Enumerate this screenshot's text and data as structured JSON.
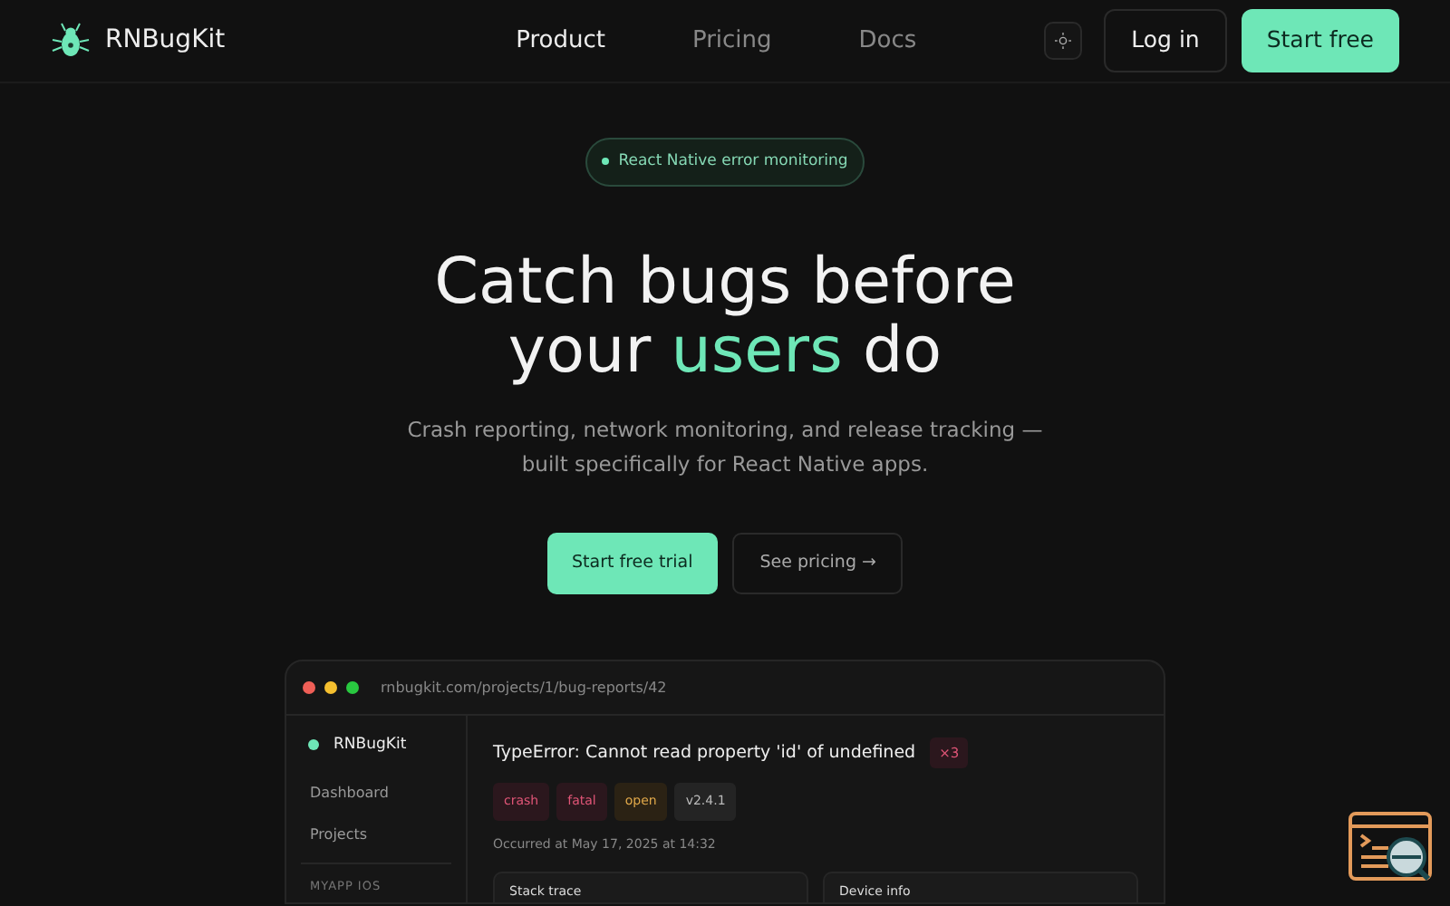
{
  "brand": "RNBugKit",
  "nav": [
    {
      "label": "Product",
      "selected": true
    },
    {
      "label": "Pricing",
      "selected": false
    },
    {
      "label": "Docs",
      "selected": false
    }
  ],
  "login": "Log in",
  "start": "Start free",
  "pill": "React Native error monitoring",
  "headline": {
    "before": "Catch bugs before",
    "line2_pre": "your ",
    "accent": "users",
    "line2_post": " do"
  },
  "subtitle": "Crash reporting, network monitoring, and release tracking — built specifically for React Native apps.",
  "cta_primary": "Start free trial",
  "cta_secondary": "See pricing →",
  "preview": {
    "url": "rnbugkit.com/projects/1/bug-reports/42",
    "sidebar": {
      "brand": "RNBugKit",
      "items": [
        "Dashboard",
        "Projects"
      ],
      "section": "MYAPP IOS"
    },
    "error_title": "TypeError: Cannot read property 'id' of undefined",
    "count": "×3",
    "tags": [
      {
        "label": "crash",
        "kind": "danger"
      },
      {
        "label": "fatal",
        "kind": "danger"
      },
      {
        "label": "open",
        "kind": "warning"
      },
      {
        "label": "v2.4.1",
        "kind": "neutral"
      }
    ],
    "occurred": "Occurred at May 17, 2025 at 14:32",
    "panels": [
      "Stack trace",
      "Device info"
    ]
  }
}
